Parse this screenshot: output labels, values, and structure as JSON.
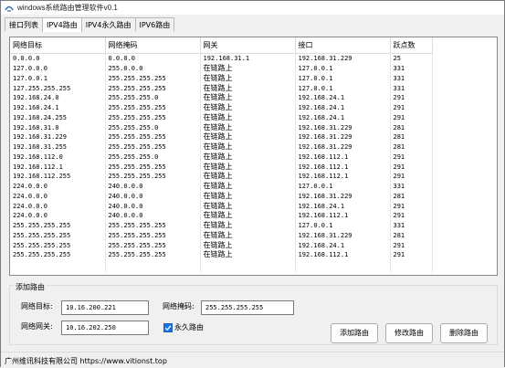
{
  "window": {
    "title": "windows系统路由管理软件v0.1"
  },
  "tabs": [
    "接口列表",
    "IPV4路由",
    "IPV4永久路由",
    "IPV6路由"
  ],
  "table": {
    "columns": [
      "网络目标",
      "网络掩码",
      "网关",
      "接口",
      "跃点数"
    ],
    "rows": [
      [
        "0.0.0.0",
        "0.0.0.0",
        "192.168.31.1",
        "192.168.31.229",
        "25"
      ],
      [
        "127.0.0.0",
        "255.0.0.0",
        "在链路上",
        "127.0.0.1",
        "331"
      ],
      [
        "127.0.0.1",
        "255.255.255.255",
        "在链路上",
        "127.0.0.1",
        "331"
      ],
      [
        "127.255.255.255",
        "255.255.255.255",
        "在链路上",
        "127.0.0.1",
        "331"
      ],
      [
        "192.168.24.0",
        "255.255.255.0",
        "在链路上",
        "192.168.24.1",
        "291"
      ],
      [
        "192.168.24.1",
        "255.255.255.255",
        "在链路上",
        "192.168.24.1",
        "291"
      ],
      [
        "192.168.24.255",
        "255.255.255.255",
        "在链路上",
        "192.168.24.1",
        "291"
      ],
      [
        "192.168.31.0",
        "255.255.255.0",
        "在链路上",
        "192.168.31.229",
        "281"
      ],
      [
        "192.168.31.229",
        "255.255.255.255",
        "在链路上",
        "192.168.31.229",
        "281"
      ],
      [
        "192.168.31.255",
        "255.255.255.255",
        "在链路上",
        "192.168.31.229",
        "281"
      ],
      [
        "192.168.112.0",
        "255.255.255.0",
        "在链路上",
        "192.168.112.1",
        "291"
      ],
      [
        "192.168.112.1",
        "255.255.255.255",
        "在链路上",
        "192.168.112.1",
        "291"
      ],
      [
        "192.168.112.255",
        "255.255.255.255",
        "在链路上",
        "192.168.112.1",
        "291"
      ],
      [
        "224.0.0.0",
        "240.0.0.0",
        "在链路上",
        "127.0.0.1",
        "331"
      ],
      [
        "224.0.0.0",
        "240.0.0.0",
        "在链路上",
        "192.168.31.229",
        "281"
      ],
      [
        "224.0.0.0",
        "240.0.0.0",
        "在链路上",
        "192.168.24.1",
        "291"
      ],
      [
        "224.0.0.0",
        "240.0.0.0",
        "在链路上",
        "192.168.112.1",
        "291"
      ],
      [
        "255.255.255.255",
        "255.255.255.255",
        "在链路上",
        "127.0.0.1",
        "331"
      ],
      [
        "255.255.255.255",
        "255.255.255.255",
        "在链路上",
        "192.168.31.229",
        "281"
      ],
      [
        "255.255.255.255",
        "255.255.255.255",
        "在链路上",
        "192.168.24.1",
        "291"
      ],
      [
        "255.255.255.255",
        "255.255.255.255",
        "在链路上",
        "192.168.112.1",
        "291"
      ]
    ]
  },
  "add_route": {
    "group_title": "添加路由",
    "target_label": "网络目标:",
    "target_value": "10.16.200.221",
    "mask_label": "网络掩码:",
    "mask_value": "255.255.255.255",
    "gateway_label": "网络网关:",
    "gateway_value": "10.16.202.250",
    "permanent_label": "永久路由",
    "permanent_checked": true,
    "add_button": "添加路由",
    "modify_button": "修改路由",
    "delete_button": "删除路由"
  },
  "status": {
    "text": "广州维讯科技有限公司 https://www.vitionst.top"
  },
  "colors": {
    "accent": "#1a73e8",
    "window_bg": "#f0f0f0",
    "table_bg": "#ffffff"
  }
}
